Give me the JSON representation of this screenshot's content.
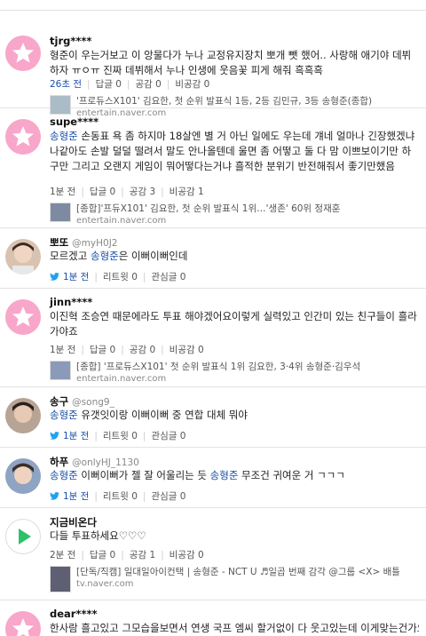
{
  "feed": [
    {
      "name": "tjrg****",
      "text_parts": [
        {
          "t": "형준이 우는거보고 이 앙물다가 누나 교정유지장치 뽀개 뺏 했어.. 사랑해 애기야 데뷔하자 ㅠㅇㅠ 진짜 데뷔해서 누나 인생에 웃음꽃 피게 해줘 흑흑흑"
        }
      ],
      "time": "26초 전",
      "reply": "답글 0",
      "like": "공감 0",
      "dislike": "비공감 0",
      "link_title": "'프로듀스X101' 김요한, 첫 순위 발표식 1등, 2등 김민규, 3등 송형준(종합)",
      "link_src": "entertain.naver.com"
    },
    {
      "name": "supe****",
      "text_parts": [
        {
          "t": "송형준",
          "hl": true
        },
        {
          "t": " 손동표 욕 좀 하지마 18살엔 별 거 아닌 일에도 우는데 걔네 얼마나 긴장했겠냐 나같아도 손발 덜덜 떨려서 말도 안나올텐데 울면 좀 어떻고 둘 다 맘 이쁘보이기만 하구만 그리고 오랜지 게임이 뭐어떻다는거냐 흘적한 분위기 반전해줘서 좋기만했음"
        }
      ],
      "time": "1분 전",
      "reply": "답글 0",
      "like": "공감 3",
      "dislike": "비공감 1",
      "link_title": "[종합]'프듀X101' 김요한, 첫 순위 발표식 1위…'생존' 60위 정재훈",
      "link_src": "entertain.naver.com"
    },
    {
      "name": "뽀또",
      "handle": "@myH0J2",
      "text_parts": [
        {
          "t": "모르겠고 "
        },
        {
          "t": "송형준",
          "hl": true
        },
        {
          "t": "은 이뻐이뻐인데"
        }
      ],
      "time": "1분 전",
      "reply": "리트윗 0",
      "like": "관심글 0"
    },
    {
      "name": "jinn****",
      "text_parts": [
        {
          "t": "이진혁 조승연 때문에라도 투표 해야겠어요이렇게 실력있고 인간미 있는 친구들이 흘라가야죠"
        }
      ],
      "time": "1분 전",
      "reply": "답글 0",
      "like": "공감 0",
      "dislike": "비공감 0",
      "link_title": "[종합] '프로듀스X101' 첫 순위 발표식 1위 김요한, 3·4위 송형준·김우석",
      "link_src": "entertain.naver.com"
    },
    {
      "name": "송구",
      "handle": "@song9_",
      "text_parts": [
        {
          "t": "송형준",
          "hl": true
        },
        {
          "t": " 유갯잇이랑 이뻐이뻐 중 연합 대체 뭐야"
        }
      ],
      "time": "1분 전",
      "reply": "리트윗 0",
      "like": "관심글 0"
    },
    {
      "name": "하푸",
      "handle": "@onlyHJ_1130",
      "text_parts": [
        {
          "t": "송형준",
          "hl": true
        },
        {
          "t": " 이뻐이뻐가 젤 잘 어울리는 듯 "
        },
        {
          "t": "송형준",
          "hl": true
        },
        {
          "t": " 무조건 귀여운 거 ㄱㄱㄱ"
        }
      ],
      "time": "1분 전",
      "reply": "리트윗 0",
      "like": "관심글 0"
    },
    {
      "name": "지금비온다",
      "text_parts": [
        {
          "t": "다들 투표하세요♡♡♡"
        }
      ],
      "time": "2분 전",
      "reply": "답글 0",
      "like": "공감 1",
      "dislike": "비공감 0",
      "link_title": "[단독/직캠] 일대일아이컨택 | 송형준 - NCT U ♬일곱 번째 감각 @그룹 <X> 배틀",
      "link_src": "tv.naver.com"
    },
    {
      "name": "dear****",
      "text_parts": [
        {
          "t": "한사람 흘고있고 그모습을보면서 연생 국프 엠씨 할거없이 다 웃고있는데 이게맞는건가요?"
        }
      ]
    }
  ],
  "colors": {
    "accent_blue": "#1a4fa8",
    "pink_avatar": "#f8a6c9",
    "twitter": "#1da1f2",
    "green_play": "#2fc16a"
  }
}
